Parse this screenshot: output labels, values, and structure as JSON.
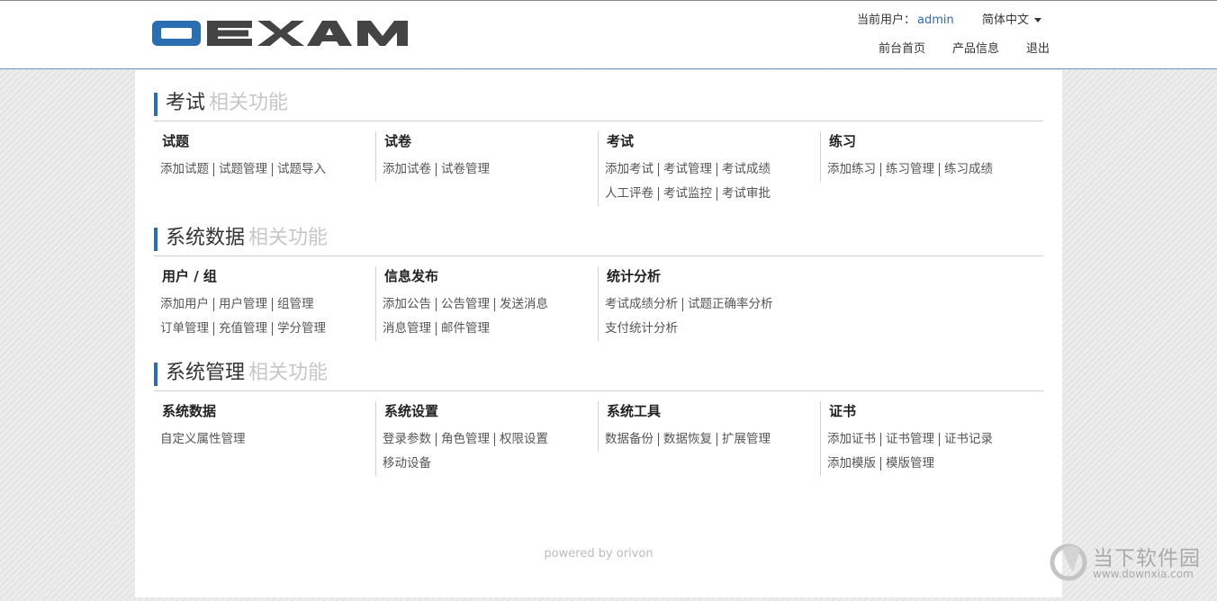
{
  "header": {
    "logo_text": "oEXAM",
    "current_user_label": "当前用户：",
    "username": "admin",
    "language": "简体中文",
    "nav": [
      "前台首页",
      "产品信息",
      "退出"
    ]
  },
  "sections": [
    {
      "title": "考试",
      "subtitle": "相关功能",
      "groups": [
        {
          "title": "试题",
          "rows": [
            [
              "添加试题",
              "试题管理",
              "试题导入"
            ]
          ]
        },
        {
          "title": "试卷",
          "rows": [
            [
              "添加试卷",
              "试卷管理"
            ]
          ]
        },
        {
          "title": "考试",
          "rows": [
            [
              "添加考试",
              "考试管理",
              "考试成绩"
            ],
            [
              "人工评卷",
              "考试监控",
              "考试审批"
            ]
          ]
        },
        {
          "title": "练习",
          "rows": [
            [
              "添加练习",
              "练习管理",
              "练习成绩"
            ]
          ]
        }
      ]
    },
    {
      "title": "系统数据",
      "subtitle": "相关功能",
      "groups": [
        {
          "title": "用户 / 组",
          "rows": [
            [
              "添加用户",
              "用户管理",
              "组管理"
            ],
            [
              "订单管理",
              "充值管理",
              "学分管理"
            ]
          ]
        },
        {
          "title": "信息发布",
          "rows": [
            [
              "添加公告",
              "公告管理",
              "发送消息"
            ],
            [
              "消息管理",
              "邮件管理"
            ]
          ]
        },
        {
          "title": "统计分析",
          "rows": [
            [
              "考试成绩分析",
              "试题正确率分析"
            ],
            [
              "支付统计分析"
            ]
          ]
        }
      ]
    },
    {
      "title": "系统管理",
      "subtitle": "相关功能",
      "groups": [
        {
          "title": "系统数据",
          "rows": [
            [
              "自定义属性管理"
            ]
          ]
        },
        {
          "title": "系统设置",
          "rows": [
            [
              "登录参数",
              "角色管理",
              "权限设置"
            ],
            [
              "移动设备"
            ]
          ]
        },
        {
          "title": "系统工具",
          "rows": [
            [
              "数据备份",
              "数据恢复",
              "扩展管理"
            ]
          ]
        },
        {
          "title": "证书",
          "rows": [
            [
              "添加证书",
              "证书管理",
              "证书记录"
            ],
            [
              "添加模版",
              "模版管理"
            ]
          ]
        }
      ]
    }
  ],
  "footer": "powered by orivon",
  "watermark": {
    "text": "当下软件园",
    "url": "www.downxia.com"
  },
  "colors": {
    "accent": "#2a6db0",
    "logo_dark": "#444444",
    "subtitle": "#c7c7c7"
  }
}
